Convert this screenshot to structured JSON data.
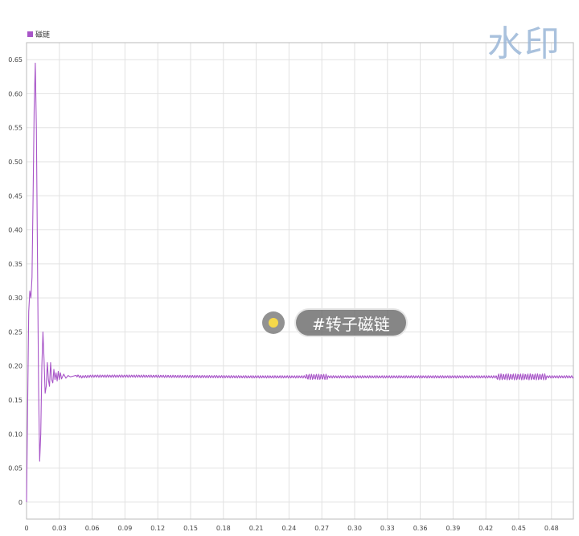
{
  "legend": {
    "label": "磁链",
    "color": "#a855c8"
  },
  "watermark": "水印",
  "tag": {
    "text": "#转子磁链",
    "dot_color": "#f5d84a"
  },
  "chart_data": {
    "type": "line",
    "xlim": [
      0,
      0.5
    ],
    "ylim": [
      -0.025,
      0.675
    ],
    "xticks": [
      0,
      0.03,
      0.06,
      0.09,
      0.12,
      0.15,
      0.18,
      0.21,
      0.24,
      0.27,
      0.3,
      0.33,
      0.36,
      0.39,
      0.42,
      0.45,
      0.48
    ],
    "xtick_labels": [
      "0",
      "0.03",
      "0.06",
      "0.09",
      "0.12",
      "0.15",
      "0.18",
      "0.21",
      "0.24",
      "0.27",
      "0.30",
      "0.33",
      "0.36",
      "0.39",
      "0.42",
      "0.45",
      "0.48"
    ],
    "yticks": [
      0,
      0.05,
      0.1,
      0.15,
      0.2,
      0.25,
      0.3,
      0.35,
      0.4,
      0.45,
      0.5,
      0.55,
      0.6,
      0.65
    ],
    "ytick_labels": [
      "0",
      "0.05",
      "0.10",
      "0.15",
      "0.20",
      "0.25",
      "0.30",
      "0.35",
      "0.40",
      "0.45",
      "0.50",
      "0.55",
      "0.60",
      "0.65"
    ],
    "grid": true,
    "legend_position": "top-left",
    "series": [
      {
        "name": "磁链",
        "color": "#a855c8",
        "x": [
          0,
          0.002,
          0.003,
          0.004,
          0.005,
          0.006,
          0.007,
          0.008,
          0.009,
          0.01,
          0.011,
          0.012,
          0.013,
          0.014,
          0.015,
          0.016,
          0.017,
          0.018,
          0.019,
          0.02,
          0.021,
          0.022,
          0.023,
          0.024,
          0.025,
          0.026,
          0.027,
          0.028,
          0.029,
          0.03,
          0.031,
          0.032,
          0.034,
          0.036,
          0.038,
          0.04,
          0.045,
          0.05,
          0.06,
          0.1,
          0.2,
          0.3,
          0.4,
          0.5
        ],
        "y": [
          0,
          0.28,
          0.31,
          0.3,
          0.33,
          0.45,
          0.58,
          0.645,
          0.55,
          0.36,
          0.17,
          0.06,
          0.1,
          0.2,
          0.25,
          0.21,
          0.16,
          0.17,
          0.205,
          0.18,
          0.17,
          0.205,
          0.18,
          0.175,
          0.195,
          0.18,
          0.19,
          0.178,
          0.192,
          0.18,
          0.19,
          0.181,
          0.188,
          0.182,
          0.186,
          0.184,
          0.186,
          0.184,
          0.185,
          0.185,
          0.184,
          0.184,
          0.184,
          0.184
        ]
      }
    ]
  }
}
